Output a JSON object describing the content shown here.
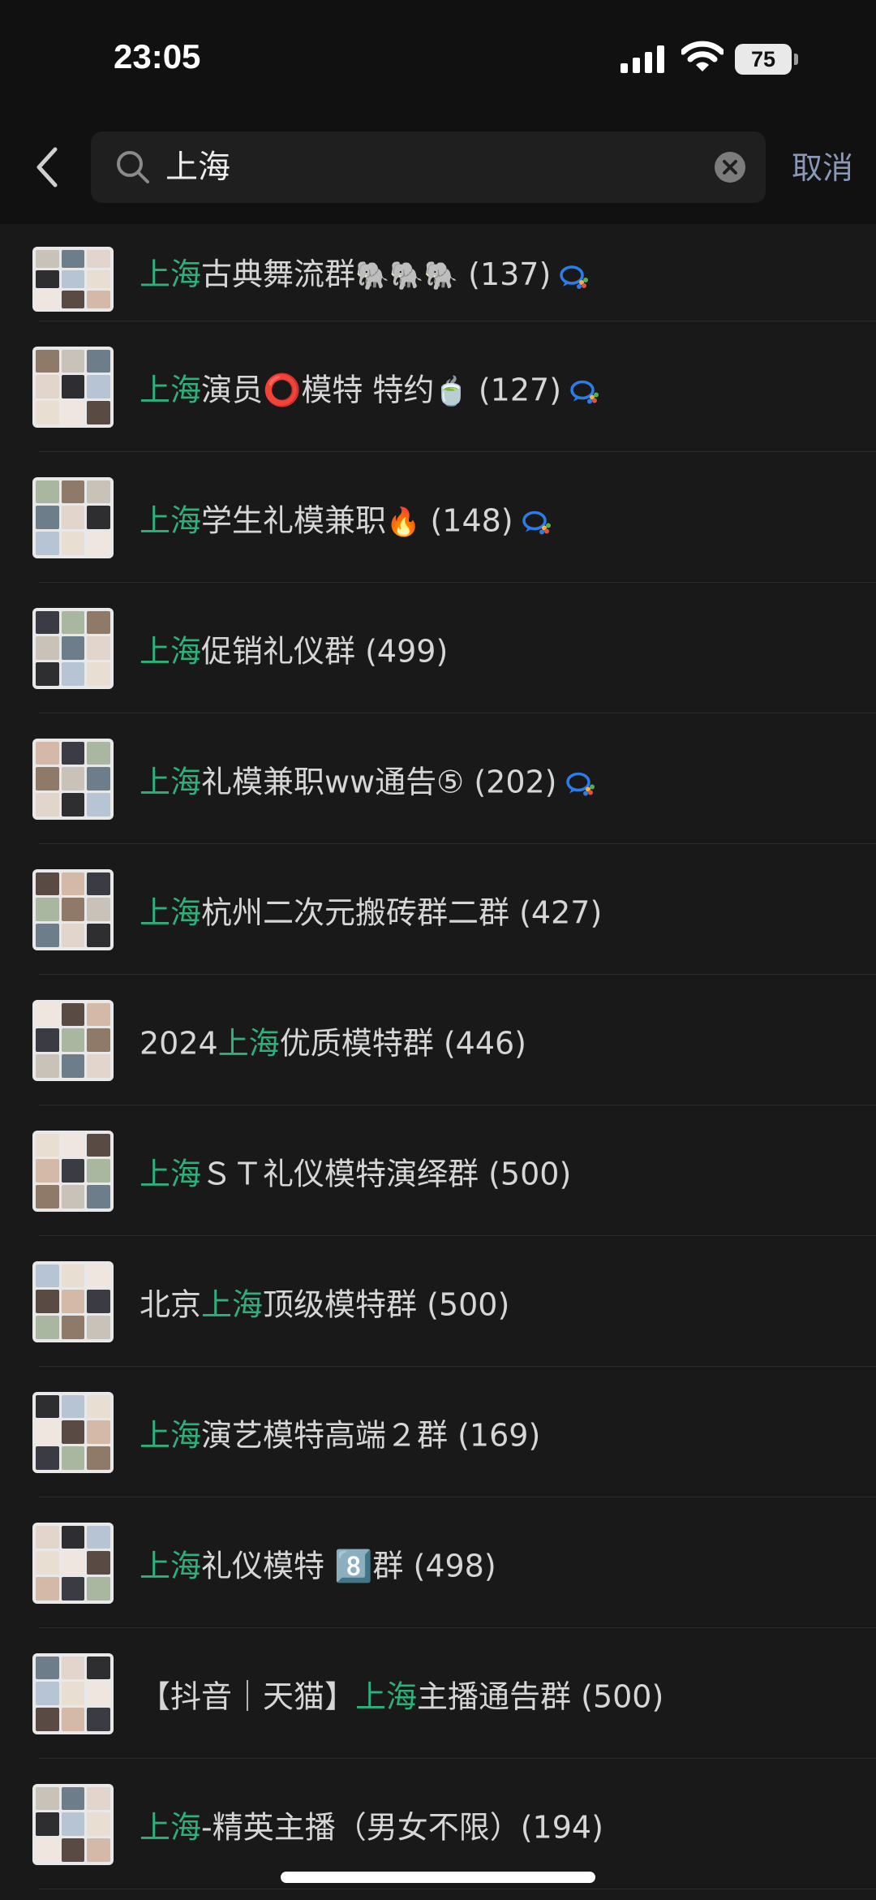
{
  "status_bar": {
    "time": "23:05",
    "battery": "75"
  },
  "search": {
    "query": "上海",
    "cancel_label": "取消"
  },
  "colors": {
    "highlight": "#2fb07a",
    "background": "#191919",
    "header": "#111111"
  },
  "results": [
    {
      "pre": "",
      "hl": "上海",
      "post": "古典舞流群",
      "emoji": "🐘🐘🐘",
      "count": " (137)",
      "wecom": true
    },
    {
      "pre": "",
      "hl": "上海",
      "post": "演员⭕模特 特约",
      "emoji": "🍵",
      "count": " (127)",
      "wecom": true
    },
    {
      "pre": "",
      "hl": "上海",
      "post": "学生礼模兼职",
      "emoji": "🔥",
      "count": " (148)",
      "wecom": true
    },
    {
      "pre": "",
      "hl": "上海",
      "post": "促销礼仪群",
      "emoji": "",
      "count": " (499)",
      "wecom": false
    },
    {
      "pre": "",
      "hl": "上海",
      "post": "礼模兼职ww通告⑤",
      "emoji": "",
      "count": " (202)",
      "wecom": true
    },
    {
      "pre": "",
      "hl": "上海",
      "post": "杭州二次元搬砖群二群",
      "emoji": "",
      "count": " (427)",
      "wecom": false
    },
    {
      "pre": "2024",
      "hl": "上海",
      "post": "优质模特群",
      "emoji": "",
      "count": " (446)",
      "wecom": false
    },
    {
      "pre": "",
      "hl": "上海",
      "post": "ＳＴ礼仪模特演绎群",
      "emoji": "",
      "count": " (500)",
      "wecom": false
    },
    {
      "pre": "北京",
      "hl": "上海",
      "post": "顶级模特群",
      "emoji": "",
      "count": " (500)",
      "wecom": false
    },
    {
      "pre": "",
      "hl": "上海",
      "post": "演艺模特高端２群",
      "emoji": "",
      "count": " (169)",
      "wecom": false
    },
    {
      "pre": "",
      "hl": "上海",
      "post": "礼仪模特 8️⃣群",
      "emoji": "",
      "count": " (498)",
      "wecom": false
    },
    {
      "pre": "【抖音｜天猫】",
      "hl": "上海",
      "post": "主播通告群",
      "emoji": "",
      "count": " (500)",
      "wecom": false
    },
    {
      "pre": "",
      "hl": "上海",
      "post": "-精英主播（男女不限）",
      "emoji": "",
      "count": "(194)",
      "wecom": false
    }
  ]
}
